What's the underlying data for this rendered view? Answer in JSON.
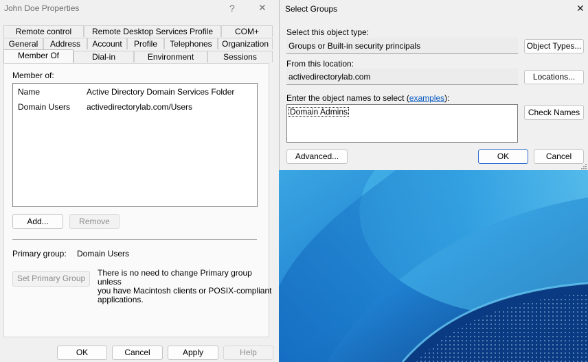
{
  "props_window": {
    "title": "John Doe Properties",
    "help_glyph": "?",
    "close_glyph": "✕",
    "tabs_row1": [
      "Remote control",
      "Remote Desktop Services Profile",
      "COM+"
    ],
    "tabs_row2": [
      "General",
      "Address",
      "Account",
      "Profile",
      "Telephones",
      "Organization"
    ],
    "tabs_row3": [
      "Member Of",
      "Dial-in",
      "Environment",
      "Sessions"
    ],
    "member_of_label": "Member of:",
    "list_header": {
      "name": "Name",
      "folder": "Active Directory Domain Services Folder"
    },
    "list_rows": [
      {
        "name": "Domain Users",
        "folder": "activedirectorylab.com/Users"
      }
    ],
    "add_button": "Add...",
    "remove_button": "Remove",
    "primary_group_label": "Primary group:",
    "primary_group_value": "Domain Users",
    "set_primary_button": "Set Primary Group",
    "info_text_line1": "There is no need to change Primary group unless",
    "info_text_line2": "you have Macintosh clients or POSIX-compliant",
    "info_text_line3": "applications.",
    "ok_button": "OK",
    "cancel_button": "Cancel",
    "apply_button": "Apply",
    "help_button": "Help"
  },
  "select_groups": {
    "title": "Select Groups",
    "close_glyph": "✕",
    "object_type_label": "Select this object type:",
    "object_type_value": "Groups or Built-in security principals",
    "object_types_button": "Object Types...",
    "location_label": "From this location:",
    "location_value": "activedirectorylab.com",
    "locations_button": "Locations...",
    "enter_names_pre": "Enter the object names to select (",
    "examples_link": "examples",
    "enter_names_post": "):",
    "names_value": "Domain Admins",
    "check_names_button": "Check Names",
    "advanced_button": "Advanced...",
    "ok_button": "OK",
    "cancel_button": "Cancel"
  },
  "colors": {
    "accent": "#2f6dd1",
    "link": "#0a5cc0",
    "desktop_dark": "#0a3f86",
    "desktop_light": "#3fb3ea"
  }
}
